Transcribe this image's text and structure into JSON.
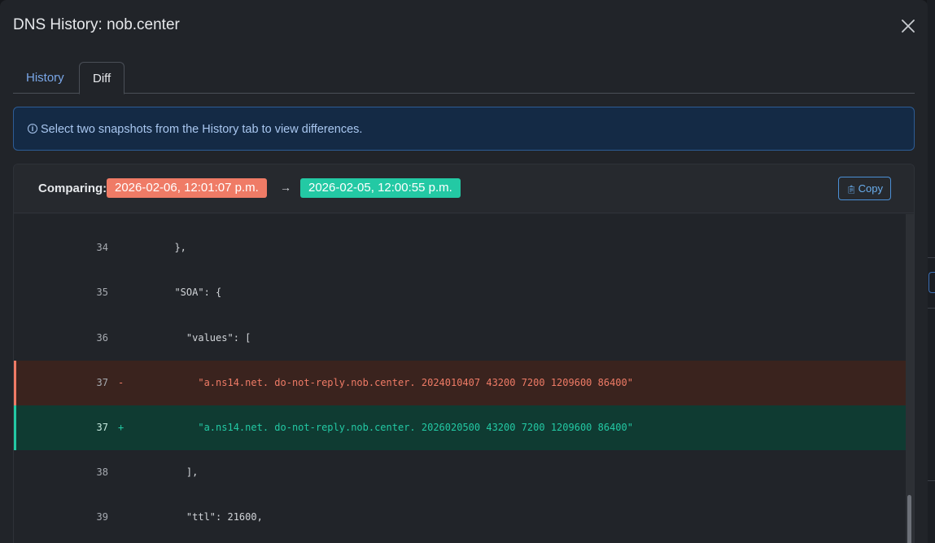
{
  "modal": {
    "title": "DNS History: nob.center",
    "close_icon": "close-icon"
  },
  "tabs": [
    {
      "label": "History",
      "active": false
    },
    {
      "label": "Diff",
      "active": true
    }
  ],
  "alert": {
    "icon": "info-icon",
    "text": "Select two snapshots from the History tab to view differences."
  },
  "diff": {
    "comparing_label": "Comparing:",
    "from_snapshot": "2026-02-06, 12:01:07 p.m.",
    "to_snapshot": "2026-02-05, 12:00:55 p.m.",
    "arrow": "→",
    "copy_label": "Copy",
    "lines": [
      {
        "num": "34",
        "sign": "",
        "text": "  },",
        "type": "context"
      },
      {
        "num": "35",
        "sign": "",
        "text": "  \"SOA\": {",
        "type": "context"
      },
      {
        "num": "36",
        "sign": "",
        "text": "    \"values\": [",
        "type": "context"
      },
      {
        "num": "37",
        "sign": "-",
        "text": "      \"a.ns14.net. do-not-reply.nob.center. 2024010407 43200 7200 1209600 86400\"",
        "type": "del"
      },
      {
        "num": "37",
        "sign": "+",
        "text": "      \"a.ns14.net. do-not-reply.nob.center. 2026020500 43200 7200 1209600 86400\"",
        "type": "add"
      },
      {
        "num": "38",
        "sign": "",
        "text": "    ],",
        "type": "context"
      },
      {
        "num": "39",
        "sign": "",
        "text": "    \"ttl\": 21600,",
        "type": "context"
      }
    ]
  },
  "colors": {
    "removed": "#ef7b66",
    "added": "#23c9a4",
    "accent": "#7aa7e8"
  }
}
